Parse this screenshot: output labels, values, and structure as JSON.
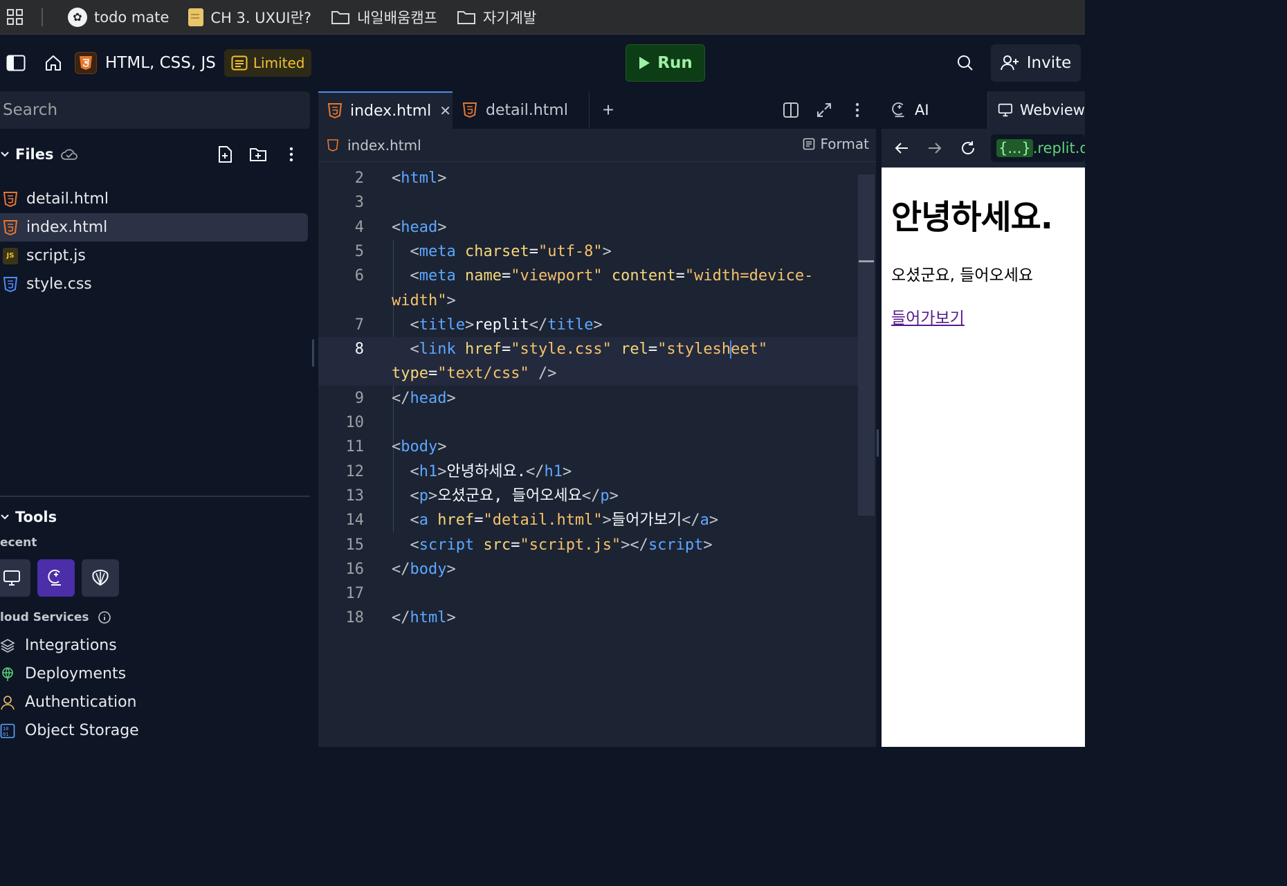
{
  "bookmarks": {
    "items": [
      {
        "label": "todo mate",
        "icon": "todo-mate-icon"
      },
      {
        "label": "CH 3. UXUI란?",
        "icon": "notion-page-icon"
      },
      {
        "label": "내일배움캠프",
        "icon": "folder-icon"
      },
      {
        "label": "자기계발",
        "icon": "folder-icon"
      }
    ]
  },
  "header": {
    "repl_title": "HTML, CSS, JS",
    "badge": "Limited",
    "run_label": "Run",
    "invite_label": "Invite"
  },
  "sidebar": {
    "search_placeholder": "Search",
    "files_title": "Files",
    "files": [
      {
        "name": "detail.html",
        "type": "html",
        "active": false
      },
      {
        "name": "index.html",
        "type": "html",
        "active": true
      },
      {
        "name": "script.js",
        "type": "js",
        "active": false
      },
      {
        "name": "style.css",
        "type": "css",
        "active": false
      }
    ],
    "tools_title": "Tools",
    "recent_label": "ecent",
    "cloud_label": "loud Services",
    "cloud_services": [
      {
        "label": "Integrations",
        "icon": "layers-icon"
      },
      {
        "label": "Deployments",
        "icon": "globe-icon"
      },
      {
        "label": "Authentication",
        "icon": "user-icon"
      },
      {
        "label": "Object Storage",
        "icon": "storage-icon"
      }
    ]
  },
  "editor": {
    "tabs": [
      {
        "label": "index.html",
        "active": true
      },
      {
        "label": "detail.html",
        "active": false
      }
    ],
    "breadcrumb": "index.html",
    "format_label": "Format",
    "current_line": "8"
  },
  "code_lines": [
    {
      "n": "2",
      "tokens": [
        [
          "t-p",
          "<"
        ],
        [
          "t-tag",
          "html"
        ],
        [
          "t-p",
          ">"
        ]
      ]
    },
    {
      "n": "3",
      "tokens": []
    },
    {
      "n": "4",
      "tokens": [
        [
          "t-p",
          "<"
        ],
        [
          "t-tag",
          "head"
        ],
        [
          "t-p",
          ">"
        ]
      ]
    },
    {
      "n": "5",
      "tokens": [
        [
          "t-p",
          "  <"
        ],
        [
          "t-tag",
          "meta"
        ],
        [
          "t-eq",
          " "
        ],
        [
          "t-at",
          "charset"
        ],
        [
          "t-eq",
          "="
        ],
        [
          "t-str",
          "\"utf-8\""
        ],
        [
          "t-p",
          ">"
        ]
      ]
    },
    {
      "n": "6",
      "tokens": [
        [
          "t-p",
          "  <"
        ],
        [
          "t-tag",
          "meta"
        ],
        [
          "t-eq",
          " "
        ],
        [
          "t-at",
          "name"
        ],
        [
          "t-eq",
          "="
        ],
        [
          "t-str",
          "\"viewport\""
        ],
        [
          "t-eq",
          " "
        ],
        [
          "t-at",
          "content"
        ],
        [
          "t-eq",
          "="
        ],
        [
          "t-str",
          "\"width=device-"
        ]
      ]
    },
    {
      "n": "",
      "tokens": [
        [
          "t-str",
          "width\""
        ],
        [
          "t-p",
          ">"
        ]
      ]
    },
    {
      "n": "7",
      "tokens": [
        [
          "t-p",
          "  <"
        ],
        [
          "t-tag",
          "title"
        ],
        [
          "t-p",
          ">"
        ],
        [
          "t-txt",
          "replit"
        ],
        [
          "t-p",
          "</"
        ],
        [
          "t-tag",
          "title"
        ],
        [
          "t-p",
          ">"
        ]
      ]
    },
    {
      "n": "8",
      "tokens": [
        [
          "t-p",
          "  <"
        ],
        [
          "t-tag",
          "link"
        ],
        [
          "t-eq",
          " "
        ],
        [
          "t-at",
          "href"
        ],
        [
          "t-eq",
          "="
        ],
        [
          "t-str",
          "\"style.css\""
        ],
        [
          "t-eq",
          " "
        ],
        [
          "t-at",
          "rel"
        ],
        [
          "t-eq",
          "="
        ],
        [
          "t-str",
          "\"styleshCURSOReet\""
        ]
      ]
    },
    {
      "n": "",
      "tokens": [
        [
          "t-at",
          "type"
        ],
        [
          "t-eq",
          "="
        ],
        [
          "t-str",
          "\"text/css\""
        ],
        [
          "t-eq",
          " "
        ],
        [
          "t-p",
          "/>"
        ]
      ]
    },
    {
      "n": "9",
      "tokens": [
        [
          "t-p",
          "</"
        ],
        [
          "t-tag",
          "head"
        ],
        [
          "t-p",
          ">"
        ]
      ]
    },
    {
      "n": "10",
      "tokens": []
    },
    {
      "n": "11",
      "tokens": [
        [
          "t-p",
          "<"
        ],
        [
          "t-tag",
          "body"
        ],
        [
          "t-p",
          ">"
        ]
      ]
    },
    {
      "n": "12",
      "tokens": [
        [
          "t-p",
          "  <"
        ],
        [
          "t-tag",
          "h1"
        ],
        [
          "t-p",
          ">"
        ],
        [
          "t-txt",
          "안녕하세요."
        ],
        [
          "t-p",
          "</"
        ],
        [
          "t-tag",
          "h1"
        ],
        [
          "t-p",
          ">"
        ]
      ]
    },
    {
      "n": "13",
      "tokens": [
        [
          "t-p",
          "  <"
        ],
        [
          "t-tag",
          "p"
        ],
        [
          "t-p",
          ">"
        ],
        [
          "t-txt",
          "오셨군요, 들어오세요"
        ],
        [
          "t-p",
          "</"
        ],
        [
          "t-tag",
          "p"
        ],
        [
          "t-p",
          ">"
        ]
      ]
    },
    {
      "n": "14",
      "tokens": [
        [
          "t-p",
          "  <"
        ],
        [
          "t-tag",
          "a"
        ],
        [
          "t-eq",
          " "
        ],
        [
          "t-at",
          "href"
        ],
        [
          "t-eq",
          "="
        ],
        [
          "t-str",
          "\"detail.html\""
        ],
        [
          "t-p",
          ">"
        ],
        [
          "t-txt",
          "들어가보기"
        ],
        [
          "t-p",
          "</"
        ],
        [
          "t-tag",
          "a"
        ],
        [
          "t-p",
          ">"
        ]
      ]
    },
    {
      "n": "15",
      "tokens": [
        [
          "t-p",
          "  <"
        ],
        [
          "t-tag",
          "script"
        ],
        [
          "t-eq",
          " "
        ],
        [
          "t-at",
          "src"
        ],
        [
          "t-eq",
          "="
        ],
        [
          "t-str",
          "\"script.js\""
        ],
        [
          "t-p",
          "></"
        ],
        [
          "t-tag",
          "script"
        ],
        [
          "t-p",
          ">"
        ]
      ]
    },
    {
      "n": "16",
      "tokens": [
        [
          "t-p",
          "</"
        ],
        [
          "t-tag",
          "body"
        ],
        [
          "t-p",
          ">"
        ]
      ]
    },
    {
      "n": "17",
      "tokens": []
    },
    {
      "n": "18",
      "tokens": [
        [
          "t-p",
          "</"
        ],
        [
          "t-tag",
          "html"
        ],
        [
          "t-p",
          ">"
        ]
      ]
    }
  ],
  "right_pane": {
    "ai_tab": "AI",
    "webview_tab": "Webview",
    "url_brace": "{...}",
    "url_rest": ".replit.dev"
  },
  "webview": {
    "heading": "안녕하세요.",
    "paragraph": "오셨군요, 들어오세요",
    "link": "들어가보기"
  },
  "colors": {
    "bg": "#0e1525",
    "panel": "#1c2333",
    "accent_blue": "#4d8cf5",
    "run_green": "#0d3d14",
    "limited_yellow": "#f1c232"
  }
}
